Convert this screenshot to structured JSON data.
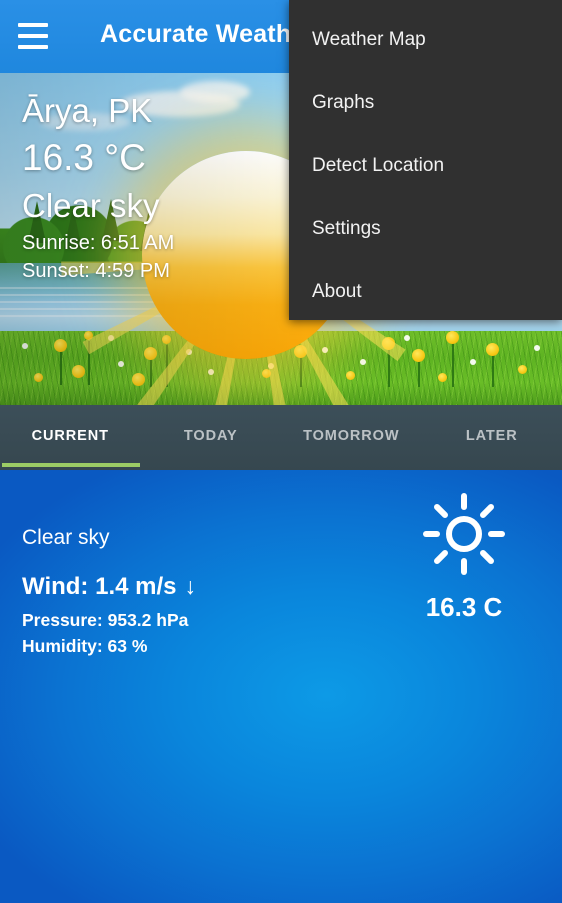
{
  "appbar": {
    "title": "Accurate Weather",
    "menu_icon": "hamburger-menu-icon",
    "background_color": "#2089e0"
  },
  "hero": {
    "city": "Ārya, PK",
    "temperature": "16.3 °C",
    "condition": "Clear sky",
    "sunrise": "Sunrise: 6:51 AM",
    "sunset": "Sunset: 4:59 PM",
    "image_description": "sunny meadow with lake and large sun"
  },
  "tabs": {
    "active_index": 0,
    "indicator_color": "#9ccc65",
    "items": [
      {
        "label": "CURRENT"
      },
      {
        "label": "TODAY"
      },
      {
        "label": "TOMORROW"
      },
      {
        "label": "LATER"
      }
    ]
  },
  "current": {
    "condition": "Clear sky",
    "wind": "Wind: 1.4 m/s",
    "wind_direction_arrow": "↓",
    "pressure": "Pressure: 953.2 hPa",
    "humidity": "Humidity: 63 %",
    "temperature": "16.3 C",
    "weather_icon": "sun-icon"
  },
  "overflow_menu": {
    "visible": true,
    "background_color": "#303030",
    "items": [
      {
        "label": "Weather Map"
      },
      {
        "label": "Graphs"
      },
      {
        "label": "Detect Location"
      },
      {
        "label": "Settings"
      },
      {
        "label": "About"
      }
    ]
  }
}
